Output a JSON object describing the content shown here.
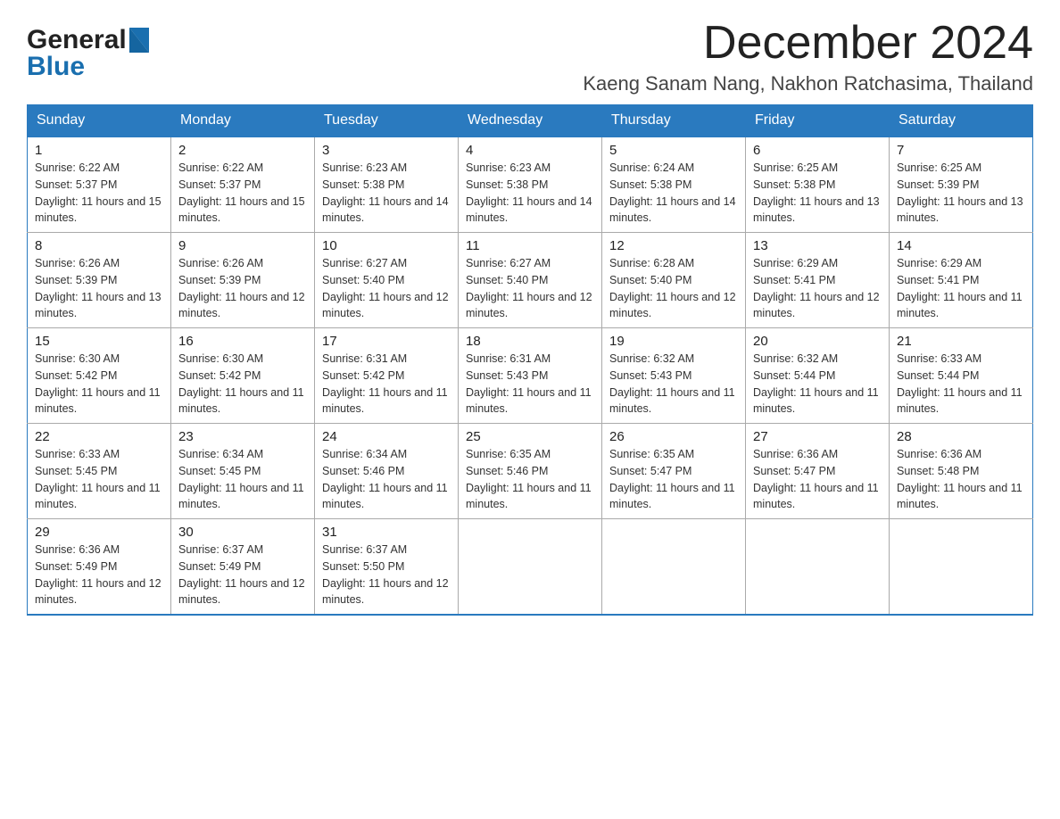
{
  "header": {
    "month_title": "December 2024",
    "location": "Kaeng Sanam Nang, Nakhon Ratchasima, Thailand",
    "logo_general": "General",
    "logo_blue": "Blue"
  },
  "days_of_week": [
    "Sunday",
    "Monday",
    "Tuesday",
    "Wednesday",
    "Thursday",
    "Friday",
    "Saturday"
  ],
  "weeks": [
    [
      {
        "day": "1",
        "sunrise": "6:22 AM",
        "sunset": "5:37 PM",
        "daylight": "11 hours and 15 minutes."
      },
      {
        "day": "2",
        "sunrise": "6:22 AM",
        "sunset": "5:37 PM",
        "daylight": "11 hours and 15 minutes."
      },
      {
        "day": "3",
        "sunrise": "6:23 AM",
        "sunset": "5:38 PM",
        "daylight": "11 hours and 14 minutes."
      },
      {
        "day": "4",
        "sunrise": "6:23 AM",
        "sunset": "5:38 PM",
        "daylight": "11 hours and 14 minutes."
      },
      {
        "day": "5",
        "sunrise": "6:24 AM",
        "sunset": "5:38 PM",
        "daylight": "11 hours and 14 minutes."
      },
      {
        "day": "6",
        "sunrise": "6:25 AM",
        "sunset": "5:38 PM",
        "daylight": "11 hours and 13 minutes."
      },
      {
        "day": "7",
        "sunrise": "6:25 AM",
        "sunset": "5:39 PM",
        "daylight": "11 hours and 13 minutes."
      }
    ],
    [
      {
        "day": "8",
        "sunrise": "6:26 AM",
        "sunset": "5:39 PM",
        "daylight": "11 hours and 13 minutes."
      },
      {
        "day": "9",
        "sunrise": "6:26 AM",
        "sunset": "5:39 PM",
        "daylight": "11 hours and 12 minutes."
      },
      {
        "day": "10",
        "sunrise": "6:27 AM",
        "sunset": "5:40 PM",
        "daylight": "11 hours and 12 minutes."
      },
      {
        "day": "11",
        "sunrise": "6:27 AM",
        "sunset": "5:40 PM",
        "daylight": "11 hours and 12 minutes."
      },
      {
        "day": "12",
        "sunrise": "6:28 AM",
        "sunset": "5:40 PM",
        "daylight": "11 hours and 12 minutes."
      },
      {
        "day": "13",
        "sunrise": "6:29 AM",
        "sunset": "5:41 PM",
        "daylight": "11 hours and 12 minutes."
      },
      {
        "day": "14",
        "sunrise": "6:29 AM",
        "sunset": "5:41 PM",
        "daylight": "11 hours and 11 minutes."
      }
    ],
    [
      {
        "day": "15",
        "sunrise": "6:30 AM",
        "sunset": "5:42 PM",
        "daylight": "11 hours and 11 minutes."
      },
      {
        "day": "16",
        "sunrise": "6:30 AM",
        "sunset": "5:42 PM",
        "daylight": "11 hours and 11 minutes."
      },
      {
        "day": "17",
        "sunrise": "6:31 AM",
        "sunset": "5:42 PM",
        "daylight": "11 hours and 11 minutes."
      },
      {
        "day": "18",
        "sunrise": "6:31 AM",
        "sunset": "5:43 PM",
        "daylight": "11 hours and 11 minutes."
      },
      {
        "day": "19",
        "sunrise": "6:32 AM",
        "sunset": "5:43 PM",
        "daylight": "11 hours and 11 minutes."
      },
      {
        "day": "20",
        "sunrise": "6:32 AM",
        "sunset": "5:44 PM",
        "daylight": "11 hours and 11 minutes."
      },
      {
        "day": "21",
        "sunrise": "6:33 AM",
        "sunset": "5:44 PM",
        "daylight": "11 hours and 11 minutes."
      }
    ],
    [
      {
        "day": "22",
        "sunrise": "6:33 AM",
        "sunset": "5:45 PM",
        "daylight": "11 hours and 11 minutes."
      },
      {
        "day": "23",
        "sunrise": "6:34 AM",
        "sunset": "5:45 PM",
        "daylight": "11 hours and 11 minutes."
      },
      {
        "day": "24",
        "sunrise": "6:34 AM",
        "sunset": "5:46 PM",
        "daylight": "11 hours and 11 minutes."
      },
      {
        "day": "25",
        "sunrise": "6:35 AM",
        "sunset": "5:46 PM",
        "daylight": "11 hours and 11 minutes."
      },
      {
        "day": "26",
        "sunrise": "6:35 AM",
        "sunset": "5:47 PM",
        "daylight": "11 hours and 11 minutes."
      },
      {
        "day": "27",
        "sunrise": "6:36 AM",
        "sunset": "5:47 PM",
        "daylight": "11 hours and 11 minutes."
      },
      {
        "day": "28",
        "sunrise": "6:36 AM",
        "sunset": "5:48 PM",
        "daylight": "11 hours and 11 minutes."
      }
    ],
    [
      {
        "day": "29",
        "sunrise": "6:36 AM",
        "sunset": "5:49 PM",
        "daylight": "11 hours and 12 minutes."
      },
      {
        "day": "30",
        "sunrise": "6:37 AM",
        "sunset": "5:49 PM",
        "daylight": "11 hours and 12 minutes."
      },
      {
        "day": "31",
        "sunrise": "6:37 AM",
        "sunset": "5:50 PM",
        "daylight": "11 hours and 12 minutes."
      },
      null,
      null,
      null,
      null
    ]
  ],
  "sunrise_label": "Sunrise:",
  "sunset_label": "Sunset:",
  "daylight_label": "Daylight:"
}
